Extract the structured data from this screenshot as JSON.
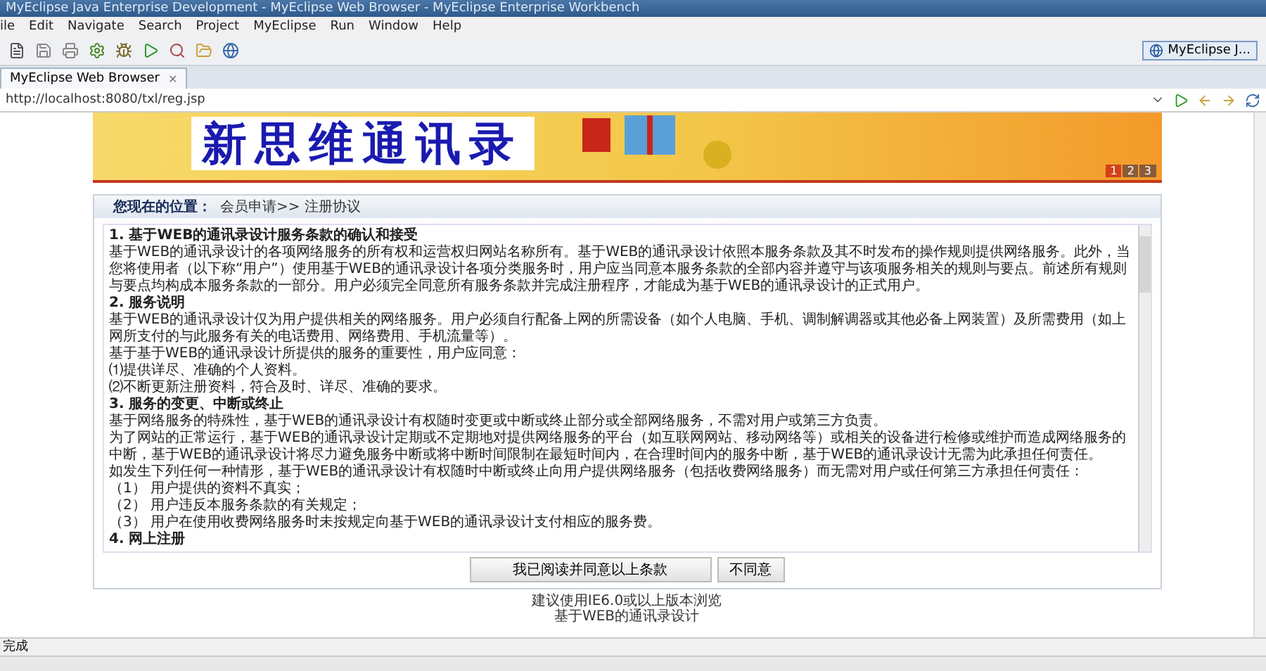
{
  "window": {
    "title": "MyEclipse Java Enterprise Development - MyEclipse Web Browser - MyEclipse Enterprise Workbench"
  },
  "menu": [
    "ile",
    "Edit",
    "Navigate",
    "Search",
    "Project",
    "MyEclipse",
    "Run",
    "Window",
    "Help"
  ],
  "perspective": {
    "label": "MyEclipse J..."
  },
  "browser_tab": {
    "title": "MyEclipse Web Browser",
    "close": "✕"
  },
  "address": {
    "value": "http://localhost:8080/txl/reg.jsp"
  },
  "banner": {
    "logo_text": "新思维通讯录",
    "slides": [
      {
        "label": "1",
        "selected": true
      },
      {
        "label": "2",
        "selected": false
      },
      {
        "label": "3",
        "selected": false
      }
    ]
  },
  "breadcrumb": {
    "label": "您现在的位置：",
    "path": "会员申请>> 注册协议"
  },
  "agreement": [
    {
      "kind": "heading",
      "text": "1. 基于WEB的通讯录设计服务条款的确认和接受"
    },
    {
      "kind": "text",
      "text": "基于WEB的通讯录设计的各项网络服务的所有权和运营权归网站名称所有。基于WEB的通讯录设计依照本服务条款及其不时发布的操作规则提供网络服务。此外，当您将使用者（以下称“用户”）使用基于WEB的通讯录设计各项分类服务时，用户应当同意本服务条款的全部内容并遵守与该项服务相关的规则与要点。前述所有规则与要点均构成本服务条款的一部分。用户必须完全同意所有服务条款并完成注册程序，才能成为基于WEB的通讯录设计的正式用户。"
    },
    {
      "kind": "heading",
      "text": "2. 服务说明"
    },
    {
      "kind": "text",
      "text": "基于WEB的通讯录设计仅为用户提供相关的网络服务。用户必须自行配备上网的所需设备（如个人电脑、手机、调制解调器或其他必备上网装置）及所需费用（如上网所支付的与此服务有关的电话费用、网络费用、手机流量等）。"
    },
    {
      "kind": "text",
      "text": "基于基于WEB的通讯录设计所提供的服务的重要性，用户应同意："
    },
    {
      "kind": "text",
      "text": "⑴提供详尽、准确的个人资料。"
    },
    {
      "kind": "text",
      "text": "⑵不断更新注册资料，符合及时、详尽、准确的要求。"
    },
    {
      "kind": "heading",
      "text": "3. 服务的变更、中断或终止"
    },
    {
      "kind": "text",
      "text": "基于网络服务的特殊性，基于WEB的通讯录设计有权随时变更或中断或终止部分或全部网络服务，不需对用户或第三方负责。"
    },
    {
      "kind": "text",
      "text": "为了网站的正常运行，基于WEB的通讯录设计定期或不定期地对提供网络服务的平台（如互联网网站、移动网络等）或相关的设备进行检修或维护而造成网络服务的中断，基于WEB的通讯录设计将尽力避免服务中断或将中断时间限制在最短时间内，在合理时间内的服务中断，基于WEB的通讯录设计无需为此承担任何责任。"
    },
    {
      "kind": "text",
      "text": "如发生下列任何一种情形，基于WEB的通讯录设计有权随时中断或终止向用户提供网络服务（包括收费网络服务）而无需对用户或任何第三方承担任何责任："
    },
    {
      "kind": "text",
      "text": "（1） 用户提供的资料不真实；"
    },
    {
      "kind": "text",
      "text": "（2） 用户违反本服务条款的有关规定；"
    },
    {
      "kind": "text",
      "text": "（3） 用户在使用收费网络服务时未按规定向基于WEB的通讯录设计支付相应的服务费。"
    },
    {
      "kind": "heading",
      "text": "4. 网上注册"
    }
  ],
  "buttons": [
    {
      "label": "我已阅读并同意以上条款",
      "kind": "agree"
    },
    {
      "label": "不同意",
      "kind": "decline"
    }
  ],
  "footer": [
    "建议使用IE6.0或以上版本浏览",
    "基于WEB的通讯录设计"
  ],
  "status_bar": {
    "text": "完成"
  }
}
